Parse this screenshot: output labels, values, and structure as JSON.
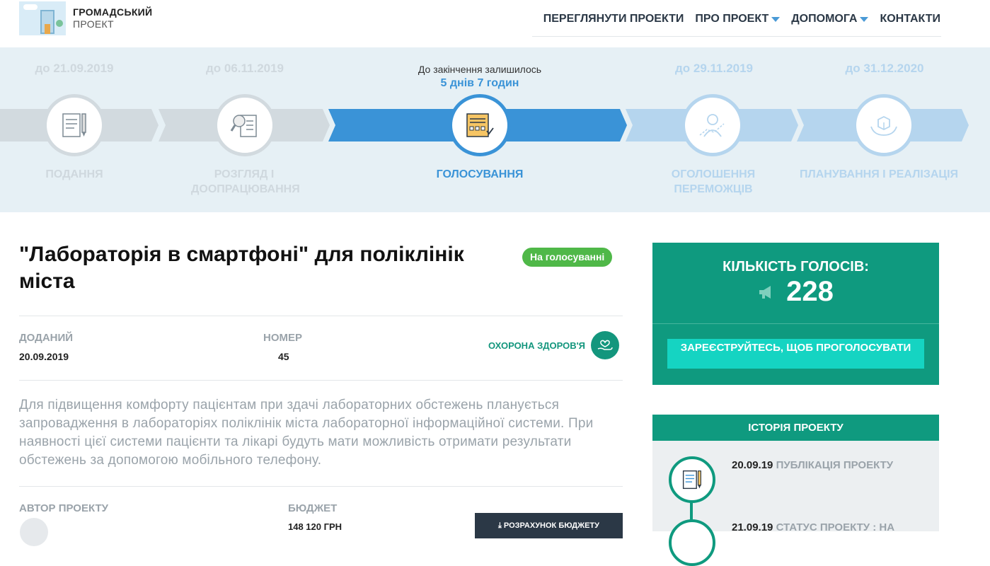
{
  "header": {
    "logo_line1": "ГРОМАДСЬКИЙ",
    "logo_line2": "ПРОЕКТ",
    "nav": [
      {
        "label": "ПЕРЕГЛЯНУТИ ПРОЕКТИ",
        "dropdown": false
      },
      {
        "label": "ПРО ПРОЕКТ",
        "dropdown": true
      },
      {
        "label": "ДОПОМОГА",
        "dropdown": true
      },
      {
        "label": "КОНТАКТИ",
        "dropdown": false
      }
    ]
  },
  "timeline": {
    "countdown_label": "До закінчення залишилось",
    "countdown_value": "5 днів 7 годин",
    "stages": [
      {
        "date": "до 21.09.2019",
        "label": "ПОДАННЯ",
        "state": "done",
        "icon": "document-pen-icon"
      },
      {
        "date": "до 06.11.2019",
        "label": "РОЗГЛЯД І ДООПРАЦЮВАННЯ",
        "state": "done",
        "icon": "magnifier-checklist-icon"
      },
      {
        "date": "",
        "label": "ГОЛОСУВАННЯ",
        "state": "active",
        "icon": "ballot-icon"
      },
      {
        "date": "до 29.11.2019",
        "label": "ОГОЛОШЕННЯ ПЕРЕМОЖЦІВ",
        "state": "upcoming",
        "icon": "winner-person-icon"
      },
      {
        "date": "до 31.12.2020",
        "label": "ПЛАНУВАННЯ І РЕАЛІЗАЦІЯ",
        "state": "upcoming",
        "icon": "hands-box-icon"
      }
    ]
  },
  "project": {
    "title": "\"Лабораторія в смартфоні\" для поліклінік міста",
    "status_badge": "На голосуванні",
    "added_label": "ДОДАНИЙ",
    "added_value": "20.09.2019",
    "number_label": "НОМЕР",
    "number_value": "45",
    "category": "ОХОРОНА ЗДОРОВ'Я",
    "description": "Для підвищення комфорту пацієнтам при здачі лабораторних обстежень планується запровадження в лабораторіях поліклінік міста лабораторної інформаційної системи. При наявності цієї системи пацієнти та лікарі будуть мати можливість отримати результати обстежень за допомогою мобільного телефону.",
    "author_label": "АВТОР ПРОЕКТУ",
    "budget_label": "БЮДЖЕТ",
    "budget_value": "148 120 ГРН",
    "budget_button": "РОЗРАХУНОК БЮДЖЕТУ"
  },
  "votes": {
    "label": "КІЛЬКІСТЬ ГОЛОСІВ:",
    "count": "228",
    "register_button": "ЗАРЕЄСТРУЙТЕСЬ, ЩОБ ПРОГОЛОСУВАТИ"
  },
  "history": {
    "title": "ІСТОРІЯ ПРОЕКТУ",
    "entries": [
      {
        "date": "20.09.19",
        "text": "ПУБЛІКАЦІЯ ПРОЕКТУ"
      },
      {
        "date": "21.09.19",
        "text": "СТАТУС ПРОЕКТУ : НА"
      }
    ]
  },
  "colors": {
    "accent_blue": "#3a93d7",
    "light_blue": "#b5d5ee",
    "teal": "#0f9a7f",
    "bright_teal": "#15d4c2",
    "green_badge": "#4fb848",
    "gray": "#d2dadf",
    "dark": "#2b3846"
  }
}
